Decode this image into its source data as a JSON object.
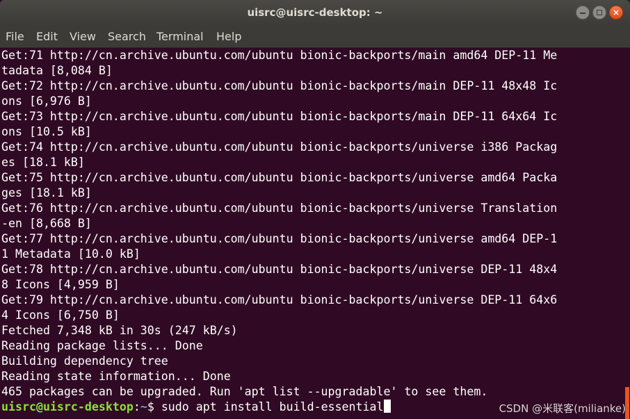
{
  "window": {
    "title": "uisrc@uisrc-desktop: ~",
    "buttons": {
      "minimize_icon": "minimize-icon",
      "maximize_icon": "maximize-icon",
      "close_icon": "close-icon",
      "close_glyph": "×"
    }
  },
  "menu": {
    "items": [
      "File",
      "Edit",
      "View",
      "Search",
      "Terminal",
      "Help"
    ]
  },
  "terminal": {
    "lines": [
      "Get:71 http://cn.archive.ubuntu.com/ubuntu bionic-backports/main amd64 DEP-11 Me",
      "tadata [8,084 B]",
      "Get:72 http://cn.archive.ubuntu.com/ubuntu bionic-backports/main DEP-11 48x48 Ic",
      "ons [6,976 B]",
      "Get:73 http://cn.archive.ubuntu.com/ubuntu bionic-backports/main DEP-11 64x64 Ic",
      "ons [10.5 kB]",
      "Get:74 http://cn.archive.ubuntu.com/ubuntu bionic-backports/universe i386 Packag",
      "es [18.1 kB]",
      "Get:75 http://cn.archive.ubuntu.com/ubuntu bionic-backports/universe amd64 Packa",
      "ges [18.1 kB]",
      "Get:76 http://cn.archive.ubuntu.com/ubuntu bionic-backports/universe Translation",
      "-en [8,668 B]",
      "Get:77 http://cn.archive.ubuntu.com/ubuntu bionic-backports/universe amd64 DEP-1",
      "1 Metadata [10.0 kB]",
      "Get:78 http://cn.archive.ubuntu.com/ubuntu bionic-backports/universe DEP-11 48x4",
      "8 Icons [4,959 B]",
      "Get:79 http://cn.archive.ubuntu.com/ubuntu bionic-backports/universe DEP-11 64x6",
      "4 Icons [6,750 B]",
      "Fetched 7,348 kB in 30s (247 kB/s)",
      "Reading package lists... Done",
      "Building dependency tree",
      "Reading state information... Done",
      "465 packages can be upgraded. Run 'apt list --upgradable' to see them."
    ],
    "prompt": {
      "user_host": "uisrc@uisrc-desktop",
      "separator": ":",
      "path": "~",
      "symbol": "$ ",
      "command": "sudo apt install build-essential"
    }
  },
  "watermark": "CSDN @米联客(milianke)",
  "colors": {
    "terminal_background": "#300a24",
    "text": "#ffffff",
    "prompt_user": "#8ae234",
    "prompt_path": "#729fcf",
    "titlebar": "#3c3b37",
    "close_button": "#df4a16",
    "scrollbar_thumb": "#e95420"
  }
}
